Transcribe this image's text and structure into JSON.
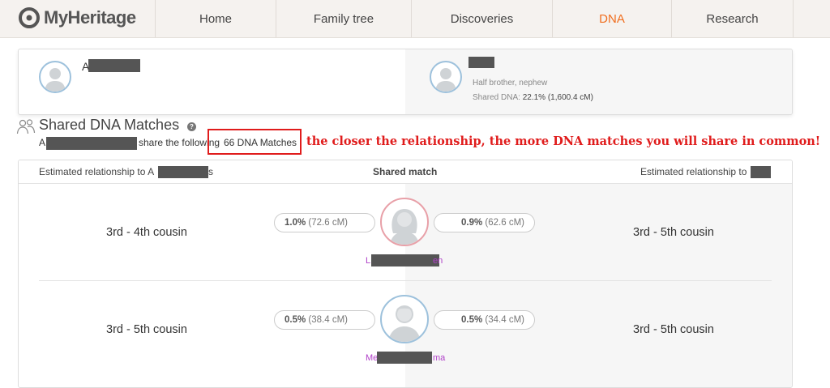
{
  "brand": {
    "name": "MyHeritage"
  },
  "nav": {
    "items": [
      {
        "label": "Home",
        "active": false
      },
      {
        "label": "Family tree",
        "active": false
      },
      {
        "label": "Discoveries",
        "active": false
      },
      {
        "label": "DNA",
        "active": true
      },
      {
        "label": "Research",
        "active": false
      }
    ]
  },
  "person_left": {
    "name_visible": "A"
  },
  "person_right": {
    "relation": "Half brother, nephew",
    "shared_dna_label": "Shared DNA:",
    "shared_dna_value": "22.1% (1,600.4 cM)"
  },
  "section": {
    "title": "Shared DNA Matches",
    "help": "?",
    "sub_prefix": "A",
    "sub_text": "share the following",
    "match_count": "66 DNA Matches"
  },
  "annotation": "the closer the relationship, the more DNA matches you will share in common!",
  "table": {
    "headers": {
      "left": "Estimated relationship to A",
      "left_suffix": "s",
      "center": "Shared match",
      "right": "Estimated relationship to"
    },
    "rows": [
      {
        "left_relationship": "3rd - 4th cousin",
        "left_pct": "1.0%",
        "left_cm": "(72.6 cM)",
        "right_pct": "0.9%",
        "right_cm": "(62.6 cM)",
        "right_relationship": "3rd - 5th cousin",
        "name_start": "L",
        "name_end": "en",
        "gender": "female"
      },
      {
        "left_relationship": "3rd - 5th cousin",
        "left_pct": "0.5%",
        "left_cm": "(38.4 cM)",
        "right_pct": "0.5%",
        "right_cm": "(34.4 cM)",
        "right_relationship": "3rd - 5th cousin",
        "name_start": "Me",
        "name_end": "ma",
        "gender": "male"
      }
    ]
  },
  "colors": {
    "accent": "#f06e1f",
    "annotation": "#e01c1c",
    "female_ring": "#e8a0a8",
    "male_ring": "#9dc1dc",
    "match_name": "#b040c8"
  }
}
